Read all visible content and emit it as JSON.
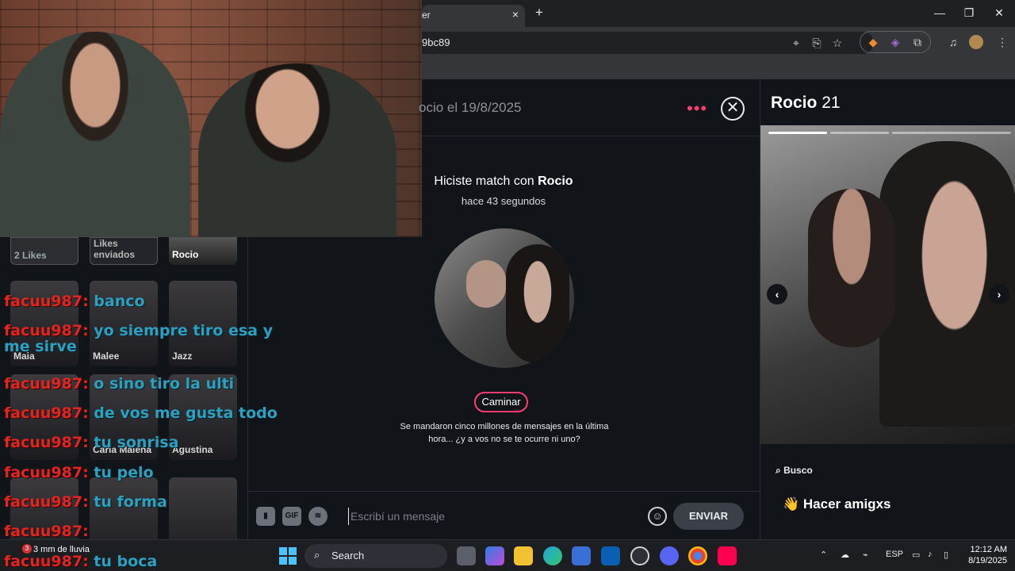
{
  "browser": {
    "tab_title": "er",
    "url": "9bc89",
    "new_tab": "+",
    "close_tab": "×",
    "win_minimize": "—",
    "win_restore": "❐",
    "win_close": "✕"
  },
  "sidebar": {
    "top_cards": [
      {
        "label": "2 Likes"
      },
      {
        "label": "Likes enviados"
      },
      {
        "label": "Rocio"
      }
    ],
    "matches": [
      {
        "name": "Maia"
      },
      {
        "name": "Malee"
      },
      {
        "name": "Jazz"
      },
      {
        "name": ""
      },
      {
        "name": "Carla Malena"
      },
      {
        "name": "Agustina"
      },
      {
        "name": ""
      },
      {
        "name": ""
      },
      {
        "name": ""
      }
    ]
  },
  "chat_overlay": [
    {
      "user": "facuu987:",
      "message": "banco"
    },
    {
      "user": "facuu987:",
      "message": "yo siempre tiro esa y me sirve"
    },
    {
      "user": "facuu987:",
      "message": "o sino tiro la ulti"
    },
    {
      "user": "facuu987:",
      "message": "de vos me gusta todo"
    },
    {
      "user": "facuu987:",
      "message": "tu sonrisa"
    },
    {
      "user": "facuu987:",
      "message": "tu pelo"
    },
    {
      "user": "facuu987:",
      "message": "tu forma"
    },
    {
      "user": "facuu987:",
      "message": ""
    },
    {
      "user": "facuu987:",
      "message": "tu boca"
    }
  ],
  "conversation": {
    "header_date": "ocio el 19/8/2025",
    "more_dots": "•••",
    "close_icon": "✕",
    "match_prefix": "Hiciste match con ",
    "match_name": "Rocio",
    "match_time": "hace 43 segundos",
    "prompt_pill": "Caminar",
    "prompt_text": "Se mandaron cinco millones de mensajes en la última hora... ¿y a vos no se te ocurre ni uno?"
  },
  "composer": {
    "gif_label": "GIF",
    "placeholder": "Escribí un mensaje",
    "send_label": "ENVIAR"
  },
  "profile": {
    "name": "Rocio",
    "age": "21",
    "photo_count": 3,
    "active_photo": 1,
    "looking_for_label": "Busco",
    "looking_for_value": "Hacer amigxs",
    "looking_for_emoji": "👋",
    "prev_arrow": "‹",
    "next_arrow": "›"
  },
  "taskbar": {
    "weather_text": "3 mm de lluvia",
    "weather_badge": "3",
    "search_label": "Search",
    "language": "ESP",
    "time": "12:12 AM",
    "date": "8/19/2025",
    "accent": "#4cc2ff"
  }
}
